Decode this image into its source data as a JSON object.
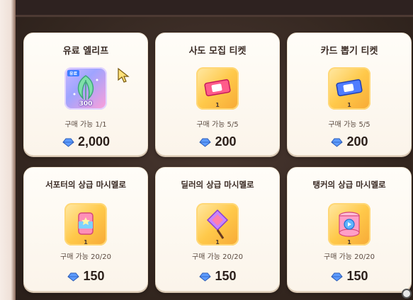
{
  "shop": {
    "currency_icon": "crystal-icon",
    "items": [
      {
        "title": "유료 엘리프",
        "icon": "elif-leaf-icon",
        "badge": "유료",
        "icon_quantity": "300",
        "limit": "구매 가능 1/1",
        "price": "2,000"
      },
      {
        "title": "사도 모집 티켓",
        "icon": "red-ticket-icon",
        "quantity": "1",
        "limit": "구매 가능 5/5",
        "price": "200"
      },
      {
        "title": "카드 뽑기 티켓",
        "icon": "blue-ticket-icon",
        "quantity": "1",
        "limit": "구매 가능 5/5",
        "price": "200"
      },
      {
        "title": "서포터의 상급 마시멜로",
        "icon": "supporter-marshmallow-icon",
        "quantity": "1",
        "limit": "구매 가능 20/20",
        "price": "150"
      },
      {
        "title": "딜러의 상급 마시멜로",
        "icon": "dealer-marshmallow-icon",
        "quantity": "1",
        "limit": "구매 가능 20/20",
        "price": "150"
      },
      {
        "title": "탱커의 상급 마시멜로",
        "icon": "tanker-marshmallow-icon",
        "quantity": "1",
        "limit": "구매 가능 20/20",
        "price": "150"
      }
    ]
  },
  "colors": {
    "card_bg": "#fffdf8",
    "panel_bg": "#33261f",
    "icon_gold": "#ffc94a",
    "crystal_blue": "#3f79d9"
  }
}
